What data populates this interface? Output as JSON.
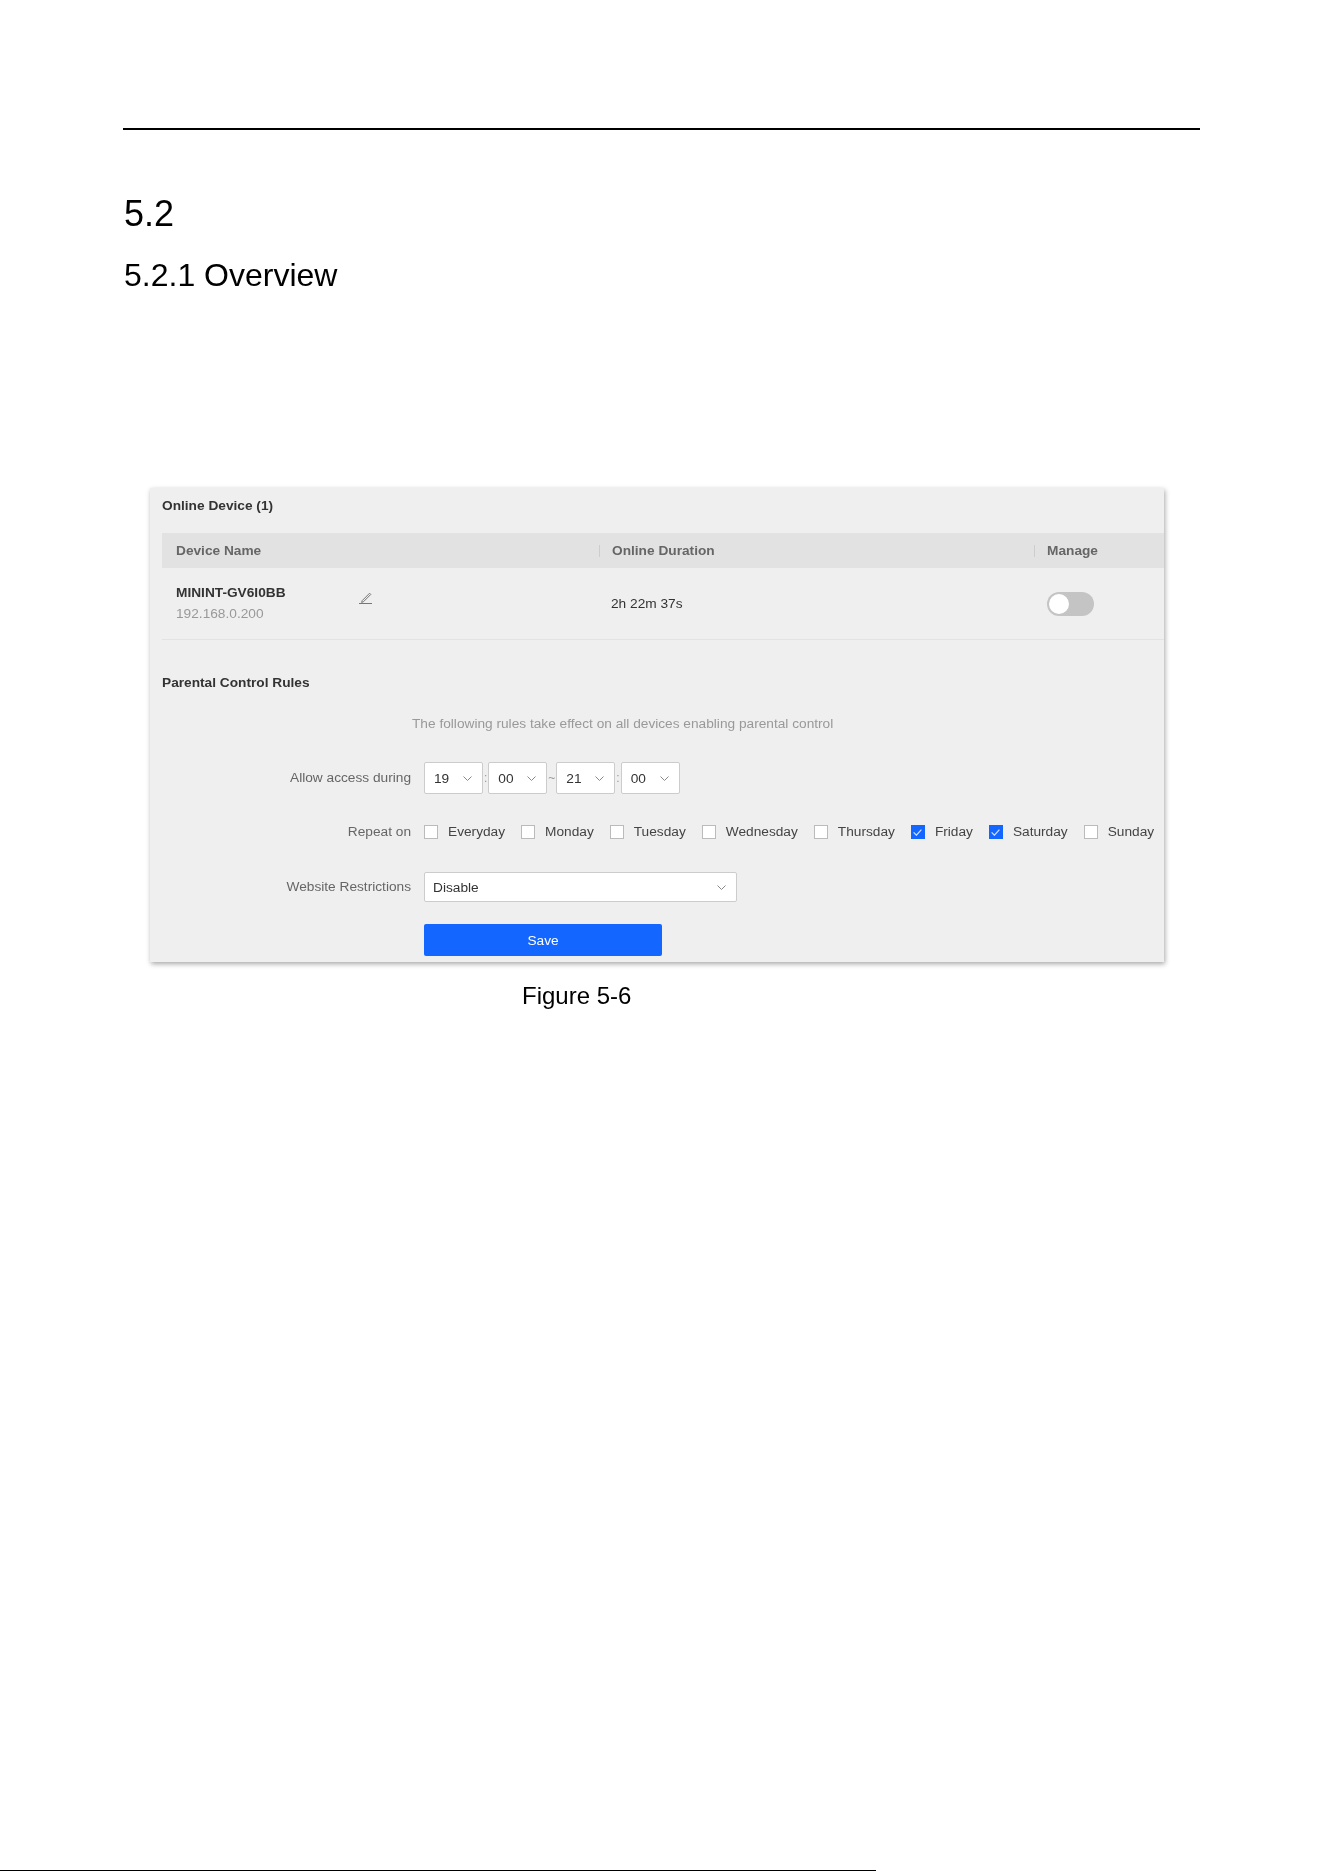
{
  "document": {
    "section_number": "5.2",
    "subsection_title": "5.2.1 Overview",
    "figure_caption": "Figure 5-6"
  },
  "online_devices": {
    "title": "Online Device (1)",
    "columns": [
      "Device Name",
      "Online Duration",
      "Manage"
    ],
    "rows": [
      {
        "device_name": "MININT-GV6I0BB",
        "ip_address": "192.168.0.200",
        "online_duration": "2h 22m 37s",
        "managed": false
      }
    ]
  },
  "parental_control_rules": {
    "title": "Parental Control Rules",
    "notice": "The following rules take effect on all devices enabling parental control",
    "allow_access": {
      "label": "Allow access during",
      "parts": [
        {
          "kind": "select",
          "value": "19"
        },
        {
          "kind": "separator",
          "text": ":"
        },
        {
          "kind": "select",
          "value": "00"
        },
        {
          "kind": "separator",
          "text": "~"
        },
        {
          "kind": "select",
          "value": "21"
        },
        {
          "kind": "separator",
          "text": ":"
        },
        {
          "kind": "select",
          "value": "00"
        }
      ]
    },
    "repeat_on": {
      "label": "Repeat on",
      "days": [
        {
          "label": "Everyday",
          "checked": false
        },
        {
          "label": "Monday",
          "checked": false
        },
        {
          "label": "Tuesday",
          "checked": false
        },
        {
          "label": "Wednesday",
          "checked": false
        },
        {
          "label": "Thursday",
          "checked": false
        },
        {
          "label": "Friday",
          "checked": true
        },
        {
          "label": "Saturday",
          "checked": true
        },
        {
          "label": "Sunday",
          "checked": false
        }
      ]
    },
    "website_restrictions": {
      "label": "Website Restrictions",
      "value": "Disable"
    },
    "save_button": "Save"
  }
}
